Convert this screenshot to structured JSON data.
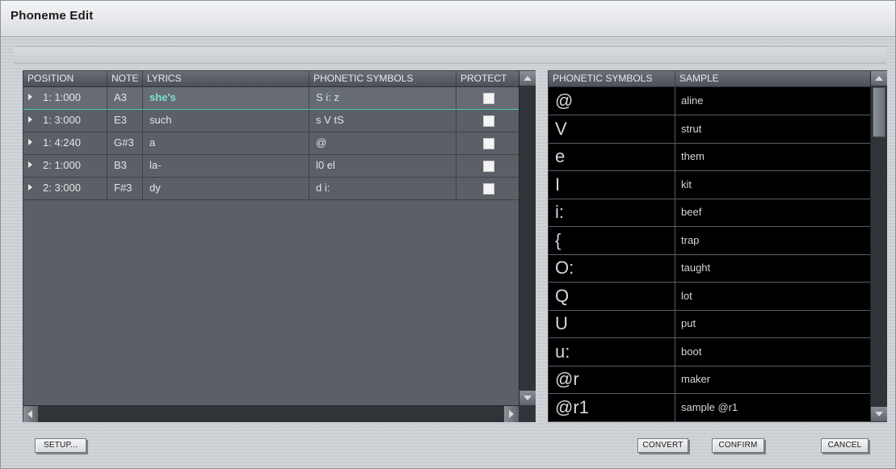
{
  "window": {
    "title": "Phoneme Edit"
  },
  "left_table": {
    "columns": [
      "POSITION",
      "NOTE",
      "LYRICS",
      "PHONETIC SYMBOLS",
      "PROTECT"
    ],
    "rows": [
      {
        "position": "1: 1:000",
        "note": "A3",
        "lyrics": "she's",
        "phonetic": "S i: z",
        "protect": false,
        "selected": true
      },
      {
        "position": "1: 3:000",
        "note": "E3",
        "lyrics": "such",
        "phonetic": "s V tS",
        "protect": false,
        "selected": false
      },
      {
        "position": "1: 4:240",
        "note": "G#3",
        "lyrics": "a",
        "phonetic": "@",
        "protect": false,
        "selected": false
      },
      {
        "position": "2: 1:000",
        "note": "B3",
        "lyrics": "la-",
        "phonetic": "l0 el",
        "protect": false,
        "selected": false
      },
      {
        "position": "2: 3:000",
        "note": "F#3",
        "lyrics": "dy",
        "phonetic": "d i:",
        "protect": false,
        "selected": false
      }
    ]
  },
  "right_table": {
    "columns": [
      "PHONETIC SYMBOLS",
      "SAMPLE"
    ],
    "rows": [
      {
        "symbol": "@",
        "sample": "aline"
      },
      {
        "symbol": "V",
        "sample": "strut"
      },
      {
        "symbol": "e",
        "sample": "them"
      },
      {
        "symbol": "I",
        "sample": "kit"
      },
      {
        "symbol": "i:",
        "sample": "beef"
      },
      {
        "symbol": "{",
        "sample": "trap"
      },
      {
        "symbol": "O:",
        "sample": "taught"
      },
      {
        "symbol": "Q",
        "sample": "lot"
      },
      {
        "symbol": "U",
        "sample": "put"
      },
      {
        "symbol": "u:",
        "sample": "boot"
      },
      {
        "symbol": "@r",
        "sample": "maker"
      },
      {
        "symbol": "@r1",
        "sample": "sample @r1"
      }
    ]
  },
  "buttons": {
    "setup": "SETUP...",
    "convert": "CONVERT",
    "confirm": "CONFIRM",
    "cancel": "CANCEL"
  },
  "colors": {
    "selection_outline": "#4cc7b4",
    "selected_lyric": "#7fe2d1",
    "table_bg": "#5b5f66",
    "symbol_table_bg": "#000000"
  }
}
